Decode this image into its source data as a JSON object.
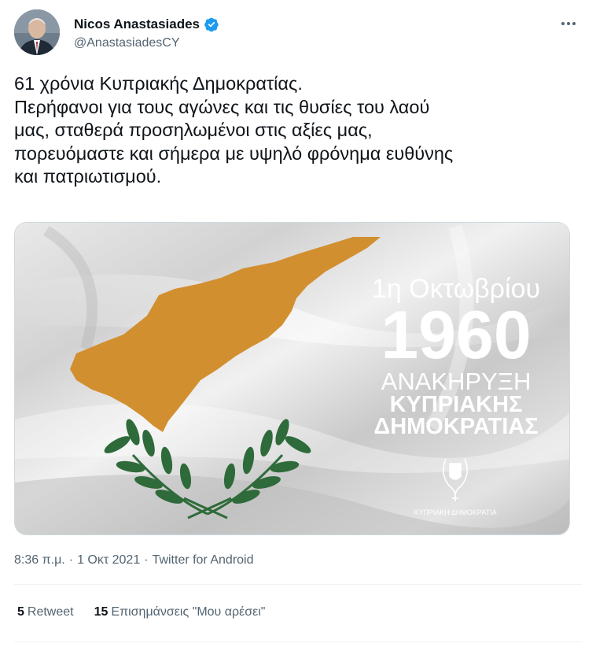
{
  "author": {
    "display_name": "Nicos Anastasiades",
    "handle": "@AnastasiadesCY",
    "verified": true
  },
  "tweet": {
    "lines": [
      "61 χρόνια Κυπριακής Δημοκρατίας.",
      "Περήφανοι για τους αγώνες και τις θυσίες του λαού",
      "μας, σταθερά προσηλωμένοι στις αξίες μας,",
      "πορευόμαστε και σήμερα με υψηλό φρόνημα ευθύνης",
      "και πατριωτισμού."
    ]
  },
  "media": {
    "date_line": "1η Οκτωβρίου",
    "year": "1960",
    "line1": "ΑΝΑΚΗΡΥΞΗ",
    "line2": "ΚΥΠΡΙΑΚΗΣ",
    "line3": "ΔΗΜΟΚΡΑΤΙΑΣ",
    "emblem_caption": "ΚΥΠΡΙΑΚΗ ΔΗΜΟΚΡΑΤΙΑ"
  },
  "meta": {
    "time": "8:36 π.μ.",
    "sep1": "·",
    "date": "1 Οκτ 2021",
    "sep2": "·",
    "source": "Twitter for Android"
  },
  "stats": {
    "retweets_count": "5",
    "retweets_label": "Retweet",
    "likes_count": "15",
    "likes_label": "Επισημάνσεις \"Μου αρέσει\""
  },
  "colors": {
    "verified": "#1d9bf0",
    "flag_island": "#d28f2f",
    "olive": "#2f6b3a",
    "secondary_text": "#536471"
  }
}
